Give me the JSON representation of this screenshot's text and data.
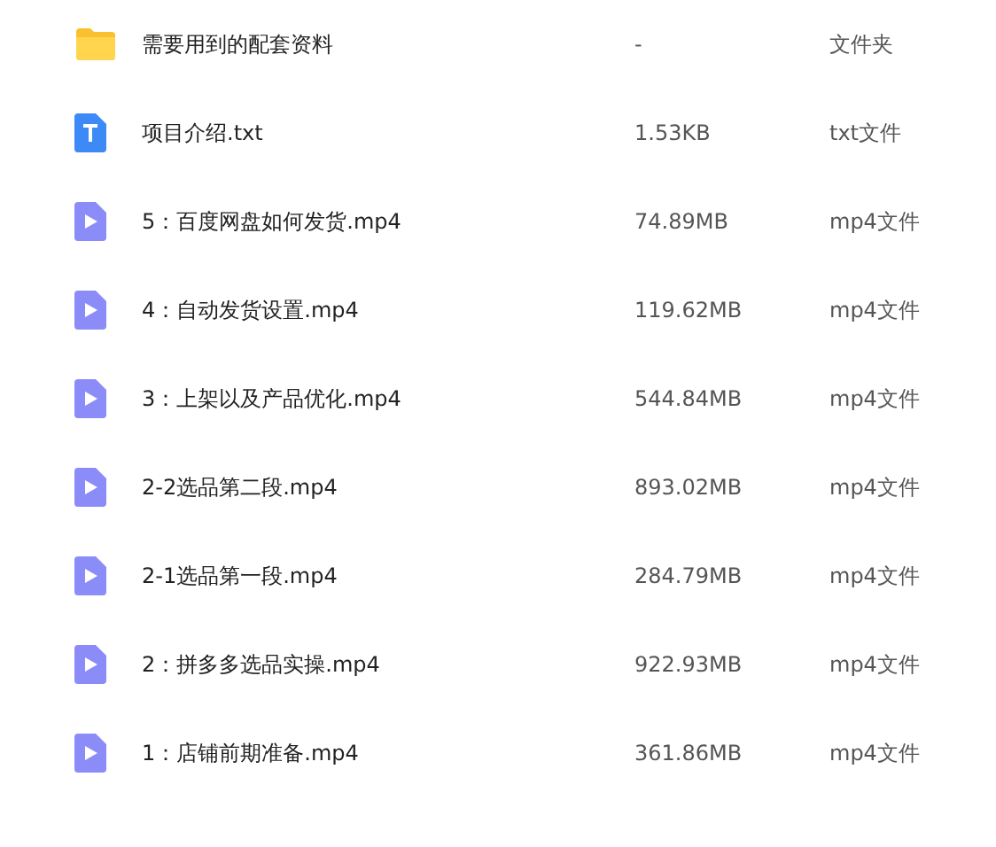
{
  "files": [
    {
      "kind": "folder",
      "name": "需要用到的配套资料",
      "size": "-",
      "type": "文件夹"
    },
    {
      "kind": "text",
      "name": "项目介绍.txt",
      "size": "1.53KB",
      "type": "txt文件"
    },
    {
      "kind": "video",
      "name": "5：百度网盘如何发货.mp4",
      "size": "74.89MB",
      "type": "mp4文件"
    },
    {
      "kind": "video",
      "name": "4：自动发货设置.mp4",
      "size": "119.62MB",
      "type": "mp4文件"
    },
    {
      "kind": "video",
      "name": "3：上架以及产品优化.mp4",
      "size": "544.84MB",
      "type": "mp4文件"
    },
    {
      "kind": "video",
      "name": "2-2选品第二段.mp4",
      "size": "893.02MB",
      "type": "mp4文件"
    },
    {
      "kind": "video",
      "name": "2-1选品第一段.mp4",
      "size": "284.79MB",
      "type": "mp4文件"
    },
    {
      "kind": "video",
      "name": "2：拼多多选品实操.mp4",
      "size": "922.93MB",
      "type": "mp4文件"
    },
    {
      "kind": "video",
      "name": "1：店铺前期准备.mp4",
      "size": "361.86MB",
      "type": "mp4文件"
    }
  ]
}
